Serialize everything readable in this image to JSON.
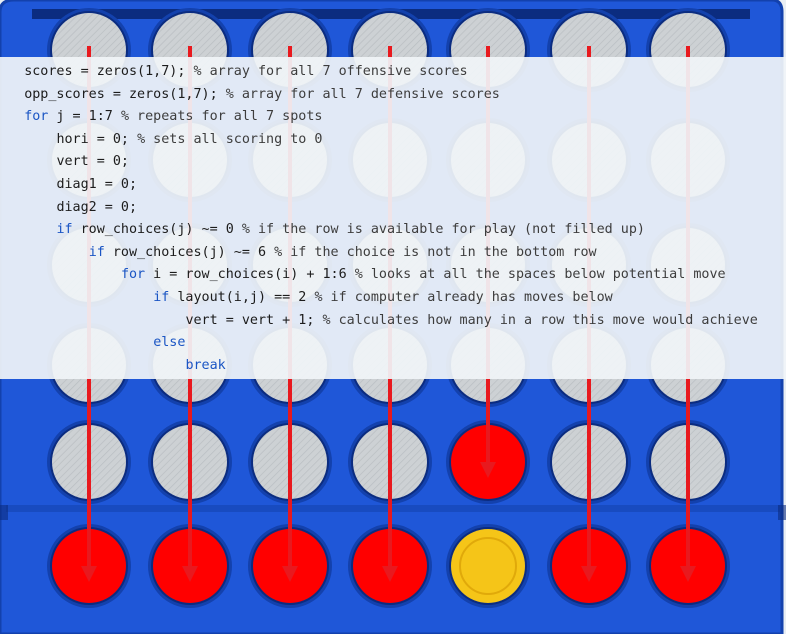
{
  "colors": {
    "board_blue": "#1f57d8",
    "board_rim": "#1341ad",
    "board_dark": "#0b2c80",
    "hole_empty": "#cfd3d6",
    "piece_red": "#ff0000",
    "piece_yellow": "#f5c518",
    "arrow_red": "#e8191e",
    "code_keyword": "#1a55c4",
    "code_text": "#1c1c1c"
  },
  "board": {
    "columns": 7,
    "rows": 6,
    "pieces": [
      [
        "empty",
        "empty",
        "empty",
        "empty",
        "empty",
        "empty",
        "empty"
      ],
      [
        "empty",
        "empty",
        "empty",
        "empty",
        "empty",
        "empty",
        "empty"
      ],
      [
        "empty",
        "empty",
        "empty",
        "empty",
        "empty",
        "empty",
        "empty"
      ],
      [
        "empty",
        "empty",
        "empty",
        "empty",
        "empty",
        "empty",
        "empty"
      ],
      [
        "empty",
        "empty",
        "empty",
        "empty",
        "red",
        "empty",
        "empty"
      ],
      [
        "red",
        "red",
        "red",
        "red",
        "yellow",
        "red",
        "red"
      ]
    ],
    "arrows": [
      {
        "column": 1,
        "ends_at_row": 5
      },
      {
        "column": 2,
        "ends_at_row": 5
      },
      {
        "column": 3,
        "ends_at_row": 5
      },
      {
        "column": 4,
        "ends_at_row": 5
      },
      {
        "column": 5,
        "ends_at_row": 4
      },
      {
        "column": 6,
        "ends_at_row": 5
      },
      {
        "column": 7,
        "ends_at_row": 5
      }
    ]
  },
  "code": {
    "lines": [
      {
        "indent": "",
        "tokens": [
          {
            "t": "scores = zeros(1,7); ",
            "c": "tx"
          },
          {
            "t": "% array for all 7 offensive scores",
            "c": "cm"
          }
        ]
      },
      {
        "indent": "",
        "tokens": [
          {
            "t": "opp_scores = zeros(1,7); ",
            "c": "tx"
          },
          {
            "t": "% array for all 7 defensive scores",
            "c": "cm"
          }
        ]
      },
      {
        "indent": "",
        "tokens": [
          {
            "t": "for",
            "c": "kw"
          },
          {
            "t": " j = 1:7 ",
            "c": "tx"
          },
          {
            "t": "% repeats for all 7 spots",
            "c": "cm"
          }
        ]
      },
      {
        "indent": "    ",
        "tokens": [
          {
            "t": "hori = 0; ",
            "c": "tx"
          },
          {
            "t": "% sets all scoring to 0",
            "c": "cm"
          }
        ]
      },
      {
        "indent": "    ",
        "tokens": [
          {
            "t": "vert = 0;",
            "c": "tx"
          }
        ]
      },
      {
        "indent": "    ",
        "tokens": [
          {
            "t": "diag1 = 0;",
            "c": "tx"
          }
        ]
      },
      {
        "indent": "    ",
        "tokens": [
          {
            "t": "diag2 = 0;",
            "c": "tx"
          }
        ]
      },
      {
        "indent": "    ",
        "tokens": [
          {
            "t": "if",
            "c": "kw"
          },
          {
            "t": " row_choices(j) ~= 0 ",
            "c": "tx"
          },
          {
            "t": "% if the row is available for play (not filled up)",
            "c": "cm"
          }
        ]
      },
      {
        "indent": "        ",
        "tokens": [
          {
            "t": "if",
            "c": "kw"
          },
          {
            "t": " row_choices(j) ~= 6 ",
            "c": "tx"
          },
          {
            "t": "% if the choice is not in the bottom row",
            "c": "cm"
          }
        ]
      },
      {
        "indent": "            ",
        "tokens": [
          {
            "t": "for",
            "c": "kw"
          },
          {
            "t": " i = row_choices(i) + 1:6 ",
            "c": "tx"
          },
          {
            "t": "% looks at all the spaces below potential move",
            "c": "cm"
          }
        ]
      },
      {
        "indent": "                ",
        "tokens": [
          {
            "t": "if",
            "c": "kw"
          },
          {
            "t": " layout(i,j) == 2 ",
            "c": "tx"
          },
          {
            "t": "% if computer already has moves below",
            "c": "cm"
          }
        ]
      },
      {
        "indent": "                    ",
        "tokens": [
          {
            "t": "vert = vert + 1; ",
            "c": "tx"
          },
          {
            "t": "% calculates how many in a row this move would achieve",
            "c": "cm"
          }
        ]
      },
      {
        "indent": "                ",
        "tokens": [
          {
            "t": "else",
            "c": "kw"
          }
        ]
      },
      {
        "indent": "                    ",
        "tokens": [
          {
            "t": "break",
            "c": "kw"
          }
        ]
      }
    ]
  }
}
